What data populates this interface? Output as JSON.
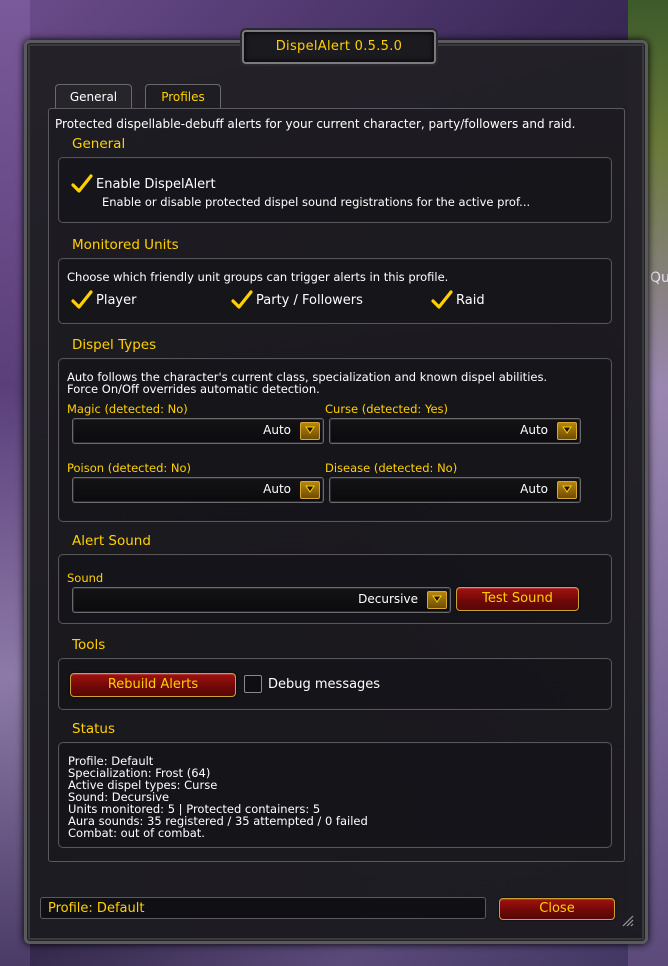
{
  "window": {
    "title": "DispelAlert 0.5.5.0"
  },
  "tabs": [
    {
      "label": "General",
      "active": true
    },
    {
      "label": "Profiles",
      "active": false
    }
  ],
  "description": "Protected dispellable-debuff alerts for your current character, party/followers and raid.",
  "general": {
    "title": "General",
    "enable_label": "Enable DispelAlert",
    "enable_checked": true,
    "enable_desc": "Enable or disable protected dispel sound registrations for the active prof..."
  },
  "monitored_units": {
    "title": "Monitored Units",
    "desc": "Choose which friendly unit groups can trigger alerts in this profile.",
    "player": {
      "label": "Player",
      "checked": true
    },
    "party": {
      "label": "Party / Followers",
      "checked": true
    },
    "raid": {
      "label": "Raid",
      "checked": true
    }
  },
  "dispel_types": {
    "title": "Dispel Types",
    "desc1": "Auto follows the character's current class, specialization and known dispel abilities.",
    "desc2": "Force On/Off overrides automatic detection.",
    "magic": {
      "label": "Magic (detected: No)",
      "value": "Auto"
    },
    "curse": {
      "label": "Curse (detected: Yes)",
      "value": "Auto"
    },
    "poison": {
      "label": "Poison (detected: No)",
      "value": "Auto"
    },
    "disease": {
      "label": "Disease (detected: No)",
      "value": "Auto"
    }
  },
  "alert_sound": {
    "title": "Alert Sound",
    "sound_label": "Sound",
    "sound_value": "Decursive",
    "test_button": "Test Sound"
  },
  "tools": {
    "title": "Tools",
    "rebuild_button": "Rebuild Alerts",
    "debug_label": "Debug messages",
    "debug_checked": false
  },
  "status": {
    "title": "Status",
    "lines": [
      "Profile: Default",
      "Specialization: Frost (64)",
      "Active dispel types: Curse",
      "Sound: Decursive",
      "Units monitored: 5 | Protected containers: 5",
      "Aura sounds: 35 registered / 35 attempted / 0 failed",
      "Combat: out of combat."
    ]
  },
  "footer": {
    "profile_text": "Profile: Default",
    "close_button": "Close"
  },
  "background": {
    "right_edge_text": "Qu"
  },
  "colors": {
    "gold": "#ffd100",
    "button_red": "#8a0d0a",
    "frame": "#222026"
  }
}
